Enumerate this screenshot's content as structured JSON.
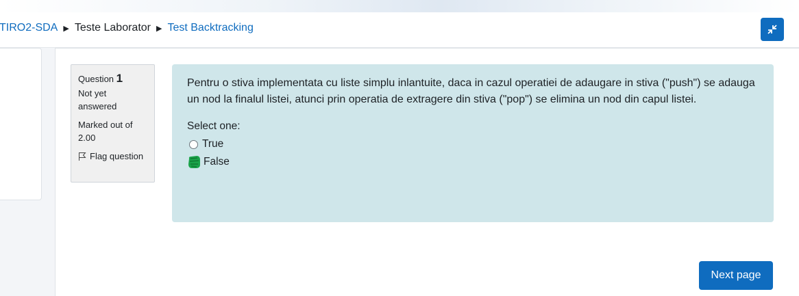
{
  "breadcrumb": {
    "items": [
      {
        "label": "TIRO2-SDA",
        "link": true
      },
      {
        "label": "Teste Laborator",
        "link": false
      },
      {
        "label": "Test Backtracking",
        "link": true
      }
    ]
  },
  "question": {
    "label": "Question",
    "number": "1",
    "state": "Not yet answered",
    "grade": "Marked out of 2.00",
    "flag_label": "Flag question",
    "text": "Pentru o stiva implementata cu liste simplu inlantuite, daca in cazul operatiei de adaugare in stiva (\"push\") se adauga un nod la finalul listei, atunci prin operatia de extragere din stiva (\"pop\") se elimina un nod din capul listei.",
    "prompt": "Select one:",
    "options": [
      {
        "label": "True",
        "selected": false
      },
      {
        "label": "False",
        "selected": true
      }
    ]
  },
  "navigation": {
    "next_label": "Next page"
  },
  "colors": {
    "primary": "#0f6cbf",
    "question_bg": "#cfe6ea",
    "info_bg": "#f0f0f0",
    "scribble": "#1aa34a"
  },
  "icons": {
    "collapse": "collapse-arrows-icon",
    "flag": "flag-icon"
  }
}
